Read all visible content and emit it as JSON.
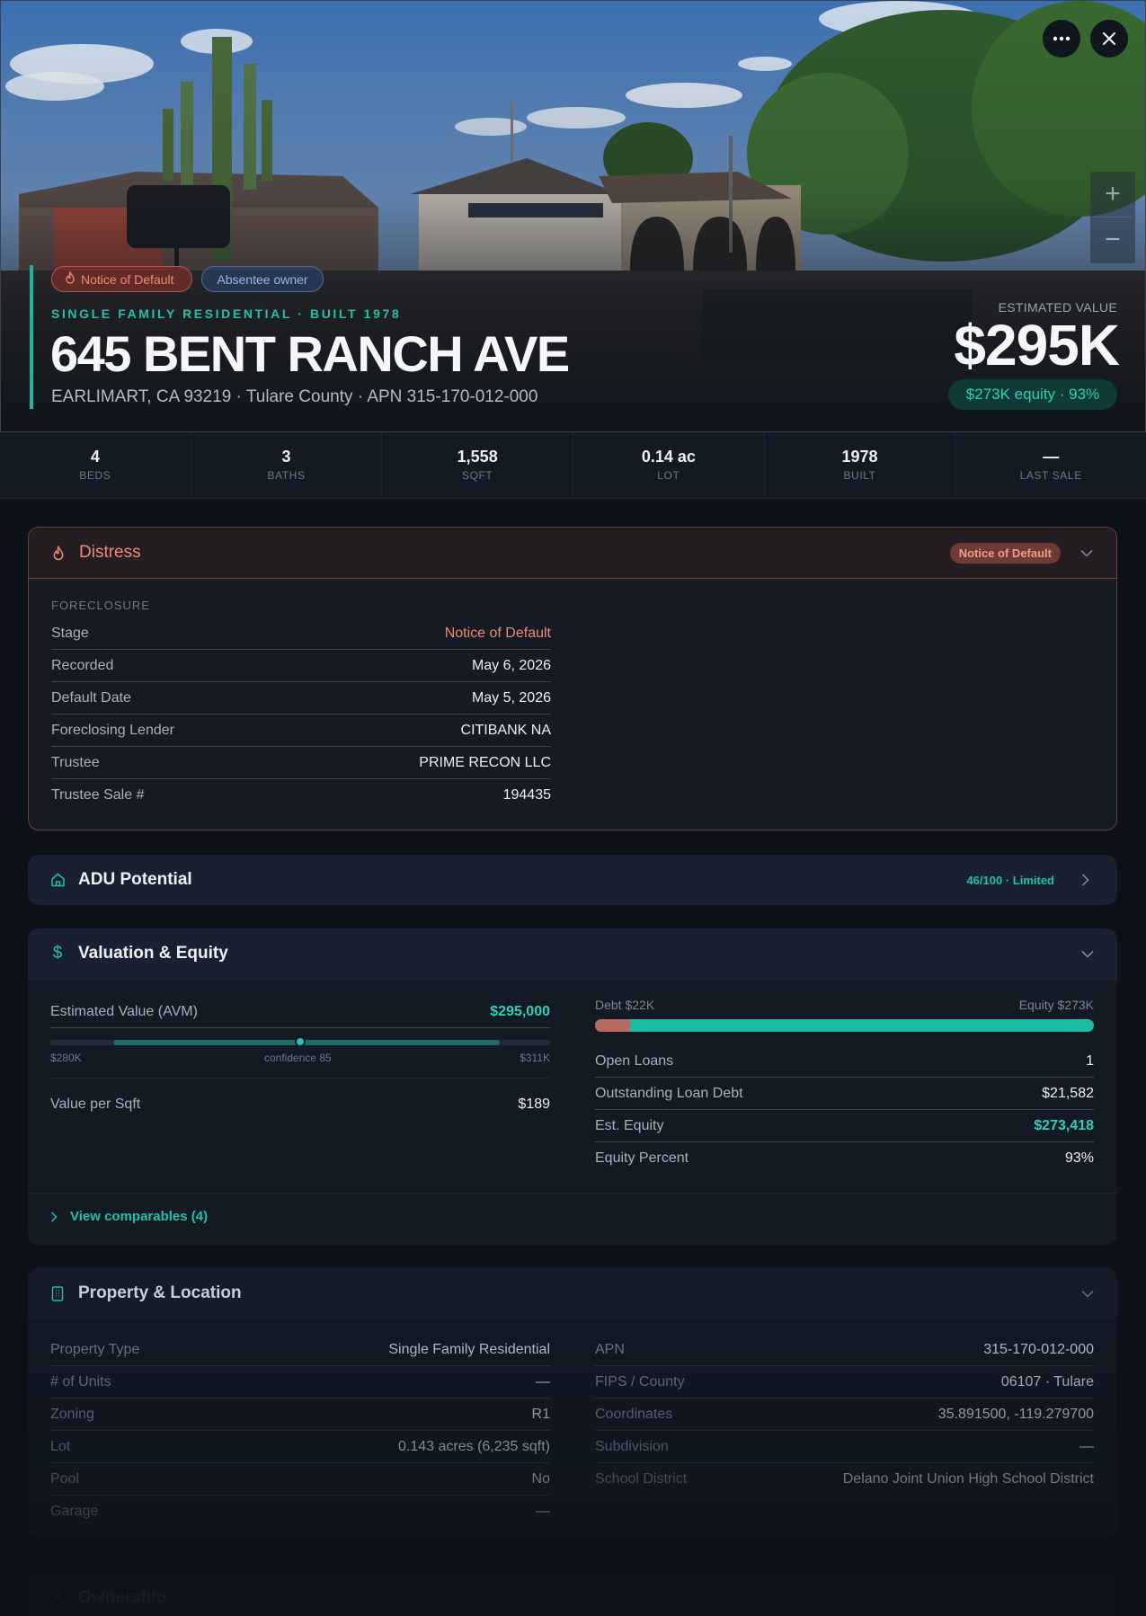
{
  "hero": {
    "tags": {
      "distress": "Notice of Default",
      "owner": "Absentee owner"
    },
    "subtitle": "SINGLE FAMILY RESIDENTIAL · BUILT 1978",
    "title": "645 BENT RANCH AVE",
    "address": "EARLIMART, CA 93219 · Tulare County · APN 315-170-012-000",
    "estimated_label": "ESTIMATED VALUE",
    "estimated_value": "$295K",
    "equity_pill": "$273K equity · 93%",
    "zoom_in": "+",
    "zoom_out": "−"
  },
  "stats": [
    {
      "value": "4",
      "label": "BEDS"
    },
    {
      "value": "3",
      "label": "BATHS"
    },
    {
      "value": "1,558",
      "label": "SQFT"
    },
    {
      "value": "0.14 ac",
      "label": "LOT"
    },
    {
      "value": "1978",
      "label": "BUILT"
    },
    {
      "value": "—",
      "label": "LAST SALE"
    }
  ],
  "distress": {
    "title": "Distress",
    "badge": "Notice of Default",
    "section": "FORECLOSURE",
    "rows": [
      {
        "k": "Stage",
        "v": "Notice of Default"
      },
      {
        "k": "Recorded",
        "v": "May 6, 2026"
      },
      {
        "k": "Default Date",
        "v": "May 5, 2026"
      },
      {
        "k": "Foreclosing Lender",
        "v": "CITIBANK NA"
      },
      {
        "k": "Trustee",
        "v": "PRIME RECON LLC"
      },
      {
        "k": "Trustee Sale #",
        "v": "194435"
      }
    ]
  },
  "adu": {
    "title": "ADU Potential",
    "score": "46/100 · Limited"
  },
  "valuation": {
    "title": "Valuation & Equity",
    "avm_label": "Estimated Value (AVM)",
    "avm_value": "$295,000",
    "range_low": "$280K",
    "confidence": "confidence 85",
    "range_high": "$311K",
    "range_low_value": 280000,
    "range_high_value": 311000,
    "avm_numeric": 295000,
    "per_sqft_label": "Value per Sqft",
    "per_sqft_value": "$189",
    "debt_label": "Debt $22K",
    "equity_label": "Equity $273K",
    "debt_fraction": 0.07,
    "rows": [
      {
        "k": "Open Loans",
        "v": "1"
      },
      {
        "k": "Outstanding Loan Debt",
        "v": "$21,582"
      },
      {
        "k": "Est. Equity",
        "v": "$273,418"
      },
      {
        "k": "Equity Percent",
        "v": "93%"
      }
    ],
    "comps_link": "View comparables (4)"
  },
  "property": {
    "title": "Property & Location",
    "left": [
      {
        "k": "Property Type",
        "v": "Single Family Residential"
      },
      {
        "k": "# of Units",
        "v": "—"
      },
      {
        "k": "Zoning",
        "v": "R1"
      },
      {
        "k": "Lot",
        "v": "0.143 acres (6,235 sqft)"
      },
      {
        "k": "Pool",
        "v": "No"
      },
      {
        "k": "Garage",
        "v": "—"
      }
    ],
    "right": [
      {
        "k": "APN",
        "v": "315-170-012-000"
      },
      {
        "k": "FIPS / County",
        "v": "06107 · Tulare"
      },
      {
        "k": "Coordinates",
        "v": "35.891500, -119.279700"
      },
      {
        "k": "Subdivision",
        "v": "—"
      },
      {
        "k": "School District",
        "v": "Delano Joint Union High School District"
      }
    ]
  },
  "ownership": {
    "title": "Ownership"
  },
  "colors": {
    "accent": "#21b3a0",
    "distress": "#ef8a78",
    "card": "#141a24",
    "page": "#0d1119"
  }
}
